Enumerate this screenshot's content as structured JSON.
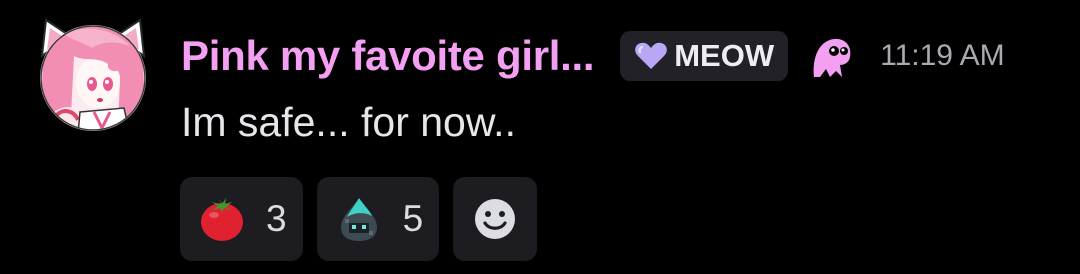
{
  "message": {
    "author": {
      "display_name": "Pink my favoite girl...",
      "name_color": "#f39ff2",
      "avatar_icon": "pink-anime-cat-girl-avatar"
    },
    "role_tag": {
      "label": "MEOW",
      "icon": "purple-heart-icon",
      "icon_color": "#b9a6f5"
    },
    "badge_icon": "pink-ghost-mascot-icon",
    "timestamp": "11:19 AM",
    "content": "Im safe... for now.."
  },
  "reactions": [
    {
      "emoji": "tomato-icon",
      "count": "3"
    },
    {
      "emoji": "teal-slime-droplet-icon",
      "count": "5"
    }
  ],
  "add_reaction": {
    "icon": "smiley-add-reaction-icon"
  }
}
